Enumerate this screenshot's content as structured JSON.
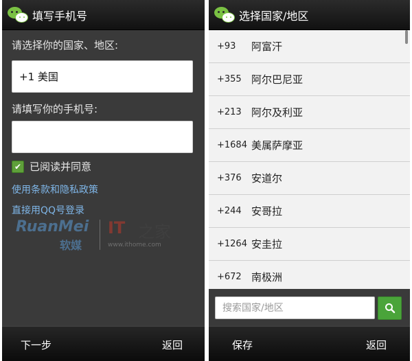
{
  "left_screen": {
    "title": "填写手机号",
    "country_label": "请选择你的国家、地区:",
    "country_value": "+1 美国",
    "phone_label": "请填写你的手机号:",
    "phone_value": "",
    "agree_checked": true,
    "agree_text": "已阅读并同意",
    "terms_link": "使用条款和隐私政策",
    "qq_link": "直接用QQ号登录",
    "next_button": "下一步",
    "back_button": "返回"
  },
  "watermark": {
    "ruanmei_en": "RuanMei",
    "ruanmei_cn": "软媒",
    "it": "IT",
    "zhi": "之家",
    "url": "www.ithome.com"
  },
  "right_screen": {
    "title": "选择国家/地区",
    "countries": [
      {
        "code": "+93",
        "name": "阿富汗"
      },
      {
        "code": "+355",
        "name": "阿尔巴尼亚"
      },
      {
        "code": "+213",
        "name": "阿尔及利亚"
      },
      {
        "code": "+1684",
        "name": "美属萨摩亚"
      },
      {
        "code": "+376",
        "name": "安道尔"
      },
      {
        "code": "+244",
        "name": "安哥拉"
      },
      {
        "code": "+1264",
        "name": "安圭拉"
      },
      {
        "code": "+672",
        "name": "南极洲"
      }
    ],
    "search_placeholder": "搜索国家/地区",
    "save_button": "保存",
    "back_button": "返回"
  },
  "colors": {
    "accent_green": "#4aa43a",
    "link_blue": "#7fb6e8",
    "panel_dark": "#3a3a3a"
  },
  "icons": {
    "app": "wechat-logo-icon",
    "checkbox": "checkmark-icon",
    "search": "search-icon"
  }
}
